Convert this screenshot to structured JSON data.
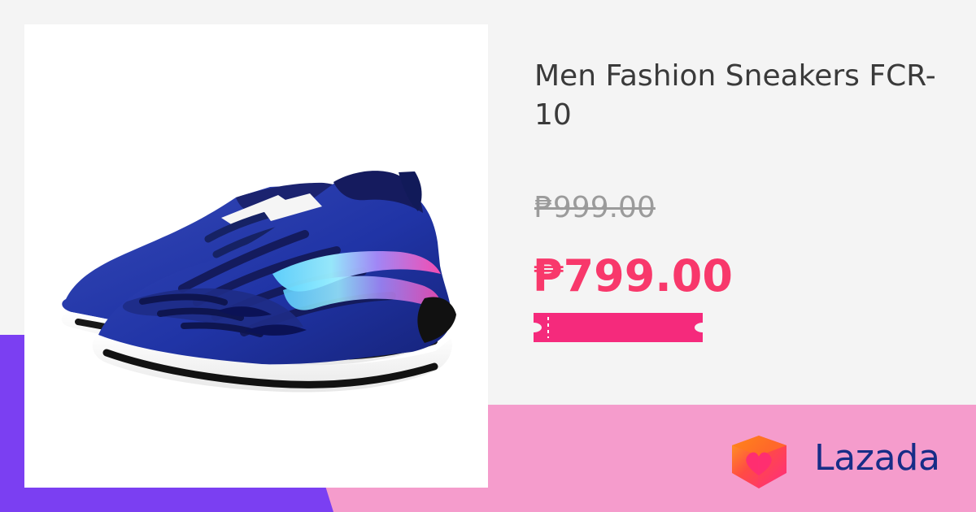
{
  "product": {
    "title": "Men Fashion Sneakers FCR-10",
    "original_price": "₱999.00",
    "sale_price": "₱799.00",
    "image_icon": "sneaker-product-image"
  },
  "brand": {
    "name": "Lazada",
    "logo_icon": "lazada-heart-box-icon"
  },
  "colors": {
    "background": "#f4f4f4",
    "purple_band": "#7b3ff2",
    "pink_band": "#f59ccc",
    "sale_price": "#f8386b",
    "voucher": "#f52a7c",
    "brand_text": "#172d87"
  }
}
